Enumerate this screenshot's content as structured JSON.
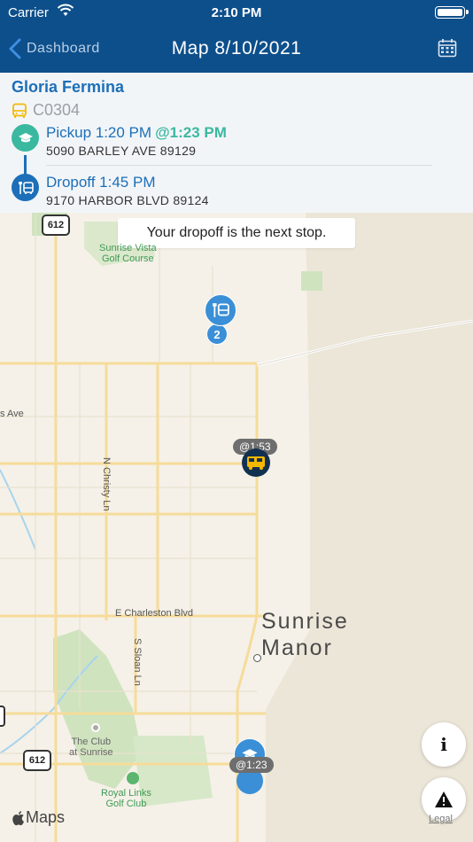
{
  "status_bar": {
    "carrier": "Carrier",
    "time": "2:10 PM"
  },
  "nav": {
    "back_label": "Dashboard",
    "title": "Map 8/10/2021"
  },
  "rider": {
    "name": "Gloria Fermina",
    "route_code": "C0304",
    "pickup": {
      "label": "Pickup 1:20 PM",
      "eta": "@1:23 PM",
      "address": "5090 BARLEY AVE 89129"
    },
    "dropoff": {
      "label": "Dropoff 1:45 PM",
      "address": "9170 HARBOR BLVD 89124"
    }
  },
  "map": {
    "banner": "Your dropoff is the next stop.",
    "labels": {
      "golf_course": "Sunrise Vista\nGolf Course",
      "ave": "s Ave",
      "christy": "N Christy Ln",
      "charleston": "E Charleston Blvd",
      "sloan": "S Sloan Ln",
      "city": "Sunrise\nManor",
      "club": "The Club\nat Sunrise",
      "royal": "Royal Links\nGolf Club"
    },
    "shield": "612",
    "cluster_count": "2",
    "bus_eta": "@1:53",
    "pickup_eta": "@1:23",
    "attribution": "Maps",
    "legal": "Legal"
  },
  "colors": {
    "nav_blue": "#0d4f8b",
    "link_blue": "#1c6fb8",
    "teal": "#3bb8a0",
    "bus_yellow": "#f5b800"
  },
  "icons": [
    "back-chevron-icon",
    "calendar-icon",
    "school-bus-icon",
    "graduation-cap-icon",
    "bus-stop-icon",
    "info-icon",
    "warning-icon",
    "apple-icon"
  ]
}
